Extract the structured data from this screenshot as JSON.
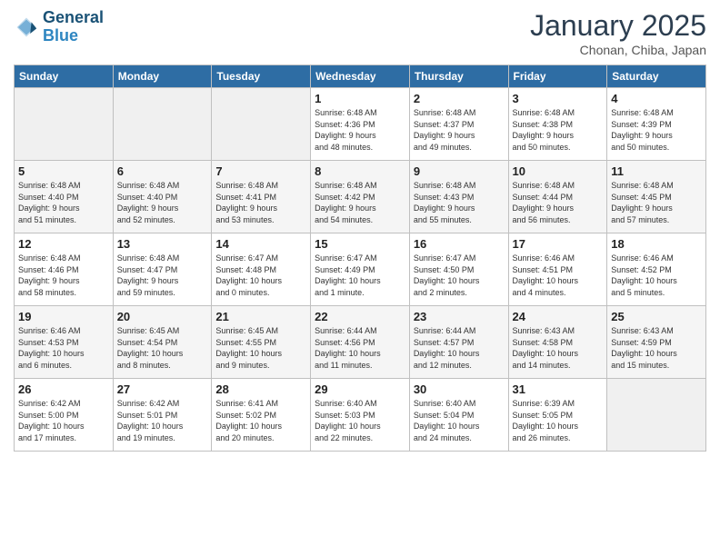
{
  "header": {
    "logo_line1": "General",
    "logo_line2": "Blue",
    "month": "January 2025",
    "location": "Chonan, Chiba, Japan"
  },
  "weekdays": [
    "Sunday",
    "Monday",
    "Tuesday",
    "Wednesday",
    "Thursday",
    "Friday",
    "Saturday"
  ],
  "weeks": [
    [
      {
        "day": "",
        "info": ""
      },
      {
        "day": "",
        "info": ""
      },
      {
        "day": "",
        "info": ""
      },
      {
        "day": "1",
        "info": "Sunrise: 6:48 AM\nSunset: 4:36 PM\nDaylight: 9 hours\nand 48 minutes."
      },
      {
        "day": "2",
        "info": "Sunrise: 6:48 AM\nSunset: 4:37 PM\nDaylight: 9 hours\nand 49 minutes."
      },
      {
        "day": "3",
        "info": "Sunrise: 6:48 AM\nSunset: 4:38 PM\nDaylight: 9 hours\nand 50 minutes."
      },
      {
        "day": "4",
        "info": "Sunrise: 6:48 AM\nSunset: 4:39 PM\nDaylight: 9 hours\nand 50 minutes."
      }
    ],
    [
      {
        "day": "5",
        "info": "Sunrise: 6:48 AM\nSunset: 4:40 PM\nDaylight: 9 hours\nand 51 minutes."
      },
      {
        "day": "6",
        "info": "Sunrise: 6:48 AM\nSunset: 4:40 PM\nDaylight: 9 hours\nand 52 minutes."
      },
      {
        "day": "7",
        "info": "Sunrise: 6:48 AM\nSunset: 4:41 PM\nDaylight: 9 hours\nand 53 minutes."
      },
      {
        "day": "8",
        "info": "Sunrise: 6:48 AM\nSunset: 4:42 PM\nDaylight: 9 hours\nand 54 minutes."
      },
      {
        "day": "9",
        "info": "Sunrise: 6:48 AM\nSunset: 4:43 PM\nDaylight: 9 hours\nand 55 minutes."
      },
      {
        "day": "10",
        "info": "Sunrise: 6:48 AM\nSunset: 4:44 PM\nDaylight: 9 hours\nand 56 minutes."
      },
      {
        "day": "11",
        "info": "Sunrise: 6:48 AM\nSunset: 4:45 PM\nDaylight: 9 hours\nand 57 minutes."
      }
    ],
    [
      {
        "day": "12",
        "info": "Sunrise: 6:48 AM\nSunset: 4:46 PM\nDaylight: 9 hours\nand 58 minutes."
      },
      {
        "day": "13",
        "info": "Sunrise: 6:48 AM\nSunset: 4:47 PM\nDaylight: 9 hours\nand 59 minutes."
      },
      {
        "day": "14",
        "info": "Sunrise: 6:47 AM\nSunset: 4:48 PM\nDaylight: 10 hours\nand 0 minutes."
      },
      {
        "day": "15",
        "info": "Sunrise: 6:47 AM\nSunset: 4:49 PM\nDaylight: 10 hours\nand 1 minute."
      },
      {
        "day": "16",
        "info": "Sunrise: 6:47 AM\nSunset: 4:50 PM\nDaylight: 10 hours\nand 2 minutes."
      },
      {
        "day": "17",
        "info": "Sunrise: 6:46 AM\nSunset: 4:51 PM\nDaylight: 10 hours\nand 4 minutes."
      },
      {
        "day": "18",
        "info": "Sunrise: 6:46 AM\nSunset: 4:52 PM\nDaylight: 10 hours\nand 5 minutes."
      }
    ],
    [
      {
        "day": "19",
        "info": "Sunrise: 6:46 AM\nSunset: 4:53 PM\nDaylight: 10 hours\nand 6 minutes."
      },
      {
        "day": "20",
        "info": "Sunrise: 6:45 AM\nSunset: 4:54 PM\nDaylight: 10 hours\nand 8 minutes."
      },
      {
        "day": "21",
        "info": "Sunrise: 6:45 AM\nSunset: 4:55 PM\nDaylight: 10 hours\nand 9 minutes."
      },
      {
        "day": "22",
        "info": "Sunrise: 6:44 AM\nSunset: 4:56 PM\nDaylight: 10 hours\nand 11 minutes."
      },
      {
        "day": "23",
        "info": "Sunrise: 6:44 AM\nSunset: 4:57 PM\nDaylight: 10 hours\nand 12 minutes."
      },
      {
        "day": "24",
        "info": "Sunrise: 6:43 AM\nSunset: 4:58 PM\nDaylight: 10 hours\nand 14 minutes."
      },
      {
        "day": "25",
        "info": "Sunrise: 6:43 AM\nSunset: 4:59 PM\nDaylight: 10 hours\nand 15 minutes."
      }
    ],
    [
      {
        "day": "26",
        "info": "Sunrise: 6:42 AM\nSunset: 5:00 PM\nDaylight: 10 hours\nand 17 minutes."
      },
      {
        "day": "27",
        "info": "Sunrise: 6:42 AM\nSunset: 5:01 PM\nDaylight: 10 hours\nand 19 minutes."
      },
      {
        "day": "28",
        "info": "Sunrise: 6:41 AM\nSunset: 5:02 PM\nDaylight: 10 hours\nand 20 minutes."
      },
      {
        "day": "29",
        "info": "Sunrise: 6:40 AM\nSunset: 5:03 PM\nDaylight: 10 hours\nand 22 minutes."
      },
      {
        "day": "30",
        "info": "Sunrise: 6:40 AM\nSunset: 5:04 PM\nDaylight: 10 hours\nand 24 minutes."
      },
      {
        "day": "31",
        "info": "Sunrise: 6:39 AM\nSunset: 5:05 PM\nDaylight: 10 hours\nand 26 minutes."
      },
      {
        "day": "",
        "info": ""
      }
    ]
  ]
}
